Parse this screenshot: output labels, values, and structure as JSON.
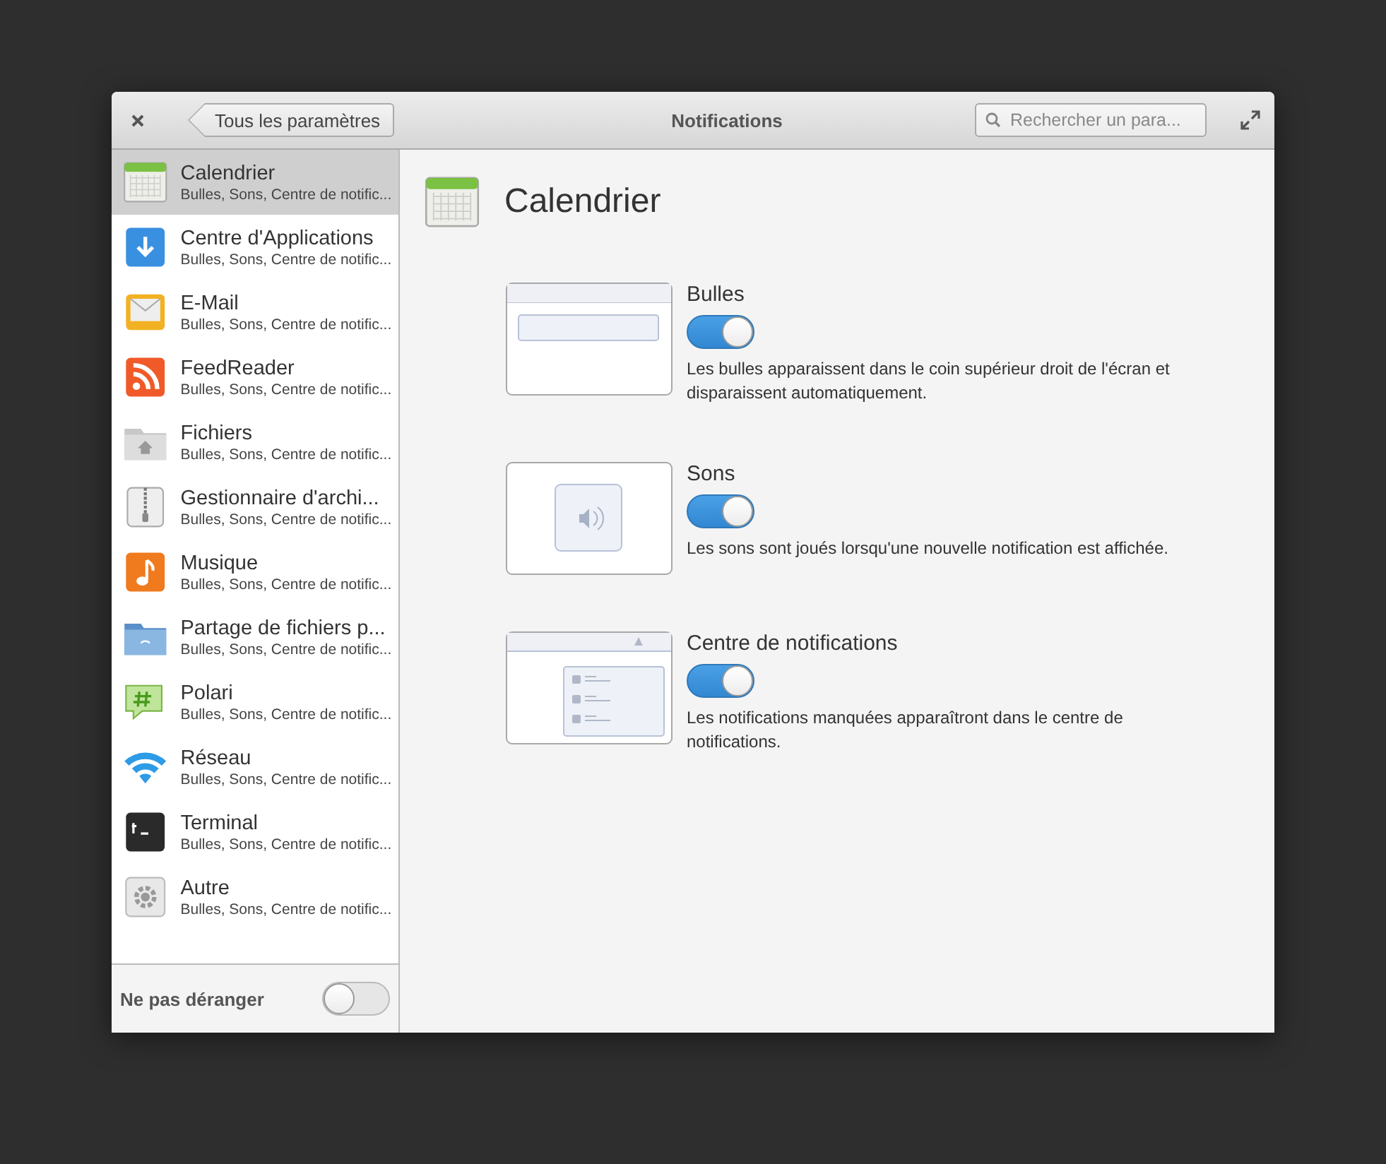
{
  "window": {
    "title": "Notifications",
    "back_button": "Tous les paramètres",
    "search": {
      "placeholder": "Rechercher un para..."
    }
  },
  "apps": [
    {
      "name": "Calendrier",
      "summary": "Bulles, Sons, Centre de notific...",
      "kind": "calendar",
      "selected": true
    },
    {
      "name": "Centre d'Applications",
      "summary": "Bulles, Sons, Centre de notific...",
      "kind": "download",
      "selected": false
    },
    {
      "name": "E-Mail",
      "summary": "Bulles, Sons, Centre de notific...",
      "kind": "mail",
      "selected": false
    },
    {
      "name": "FeedReader",
      "summary": "Bulles, Sons, Centre de notific...",
      "kind": "rss",
      "selected": false
    },
    {
      "name": "Fichiers",
      "summary": "Bulles, Sons, Centre de notific...",
      "kind": "home-folder",
      "selected": false
    },
    {
      "name": "Gestionnaire d'archi...",
      "summary": "Bulles, Sons, Centre de notific...",
      "kind": "archive",
      "selected": false
    },
    {
      "name": "Musique",
      "summary": "Bulles, Sons, Centre de notific...",
      "kind": "music",
      "selected": false
    },
    {
      "name": "Partage de fichiers p...",
      "summary": "Bulles, Sons, Centre de notific...",
      "kind": "share-folder",
      "selected": false
    },
    {
      "name": "Polari",
      "summary": "Bulles, Sons, Centre de notific...",
      "kind": "chat",
      "selected": false
    },
    {
      "name": "Réseau",
      "summary": "Bulles, Sons, Centre de notific...",
      "kind": "wifi",
      "selected": false
    },
    {
      "name": "Terminal",
      "summary": "Bulles, Sons, Centre de notific...",
      "kind": "terminal",
      "selected": false
    },
    {
      "name": "Autre",
      "summary": "Bulles, Sons, Centre de notific...",
      "kind": "gear",
      "selected": false
    }
  ],
  "do_not_disturb": {
    "label": "Ne pas déranger",
    "on": false
  },
  "detail": {
    "title": "Calendrier",
    "kind": "calendar",
    "sections": [
      {
        "title": "Bulles",
        "kind": "bubble",
        "on": true,
        "description": "Les bulles apparaissent dans le coin supérieur droit de l'écran et disparaissent automatiquement."
      },
      {
        "title": "Sons",
        "kind": "sound",
        "on": true,
        "description": "Les sons sont joués lorsqu'une nouvelle notification est affichée."
      },
      {
        "title": "Centre de notifications",
        "kind": "center",
        "on": true,
        "description": "Les notifications manquées apparaîtront dans le centre de notifications."
      }
    ]
  }
}
